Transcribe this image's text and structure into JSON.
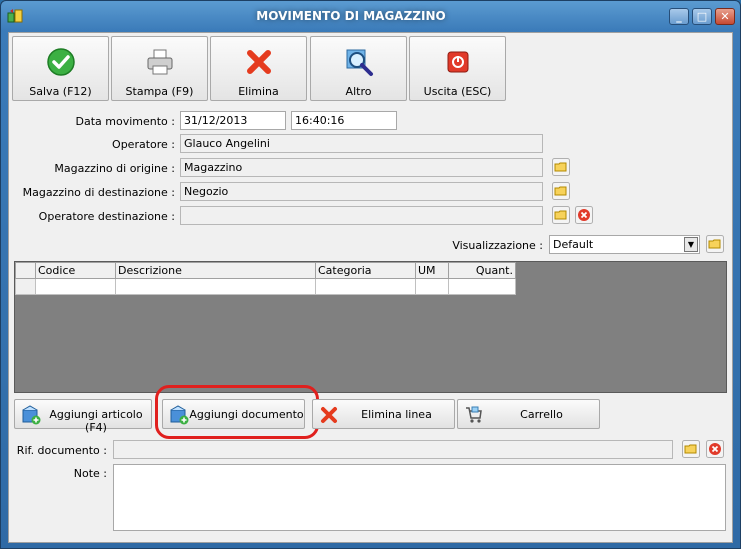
{
  "window": {
    "title": "MOVIMENTO DI MAGAZZINO",
    "min": "_",
    "max": "□",
    "close": "✕"
  },
  "toolbar": {
    "save_label": "Salva (F12)",
    "print_label": "Stampa (F9)",
    "delete_label": "Elimina",
    "other_label": "Altro",
    "exit_label": "Uscita (ESC)"
  },
  "form": {
    "date_label": "Data movimento :",
    "date_value": "31/12/2013",
    "time_value": "16:40:16",
    "operator_label": "Operatore :",
    "operator_value": "Glauco Angelini",
    "origin_label": "Magazzino di origine :",
    "origin_value": "Magazzino",
    "dest_label": "Magazzino di destinazione :",
    "dest_value": "Negozio",
    "dest_operator_label": "Operatore destinazione :",
    "dest_operator_value": "",
    "view_label": "Visualizzazione :",
    "view_value": "Default"
  },
  "grid": {
    "columns": [
      "Codice",
      "Descrizione",
      "Categoria",
      "UM",
      "Quant."
    ]
  },
  "actions": {
    "add_article": "Aggiungi articolo (F4)",
    "add_document": "Aggiungi documento",
    "delete_line": "Elimina linea",
    "cart": "Carrello"
  },
  "bottom": {
    "doc_ref_label": "Rif. documento :",
    "doc_ref_value": "",
    "notes_label": "Note :",
    "notes_value": ""
  },
  "colors": {
    "highlight": "#e0201e",
    "grid_bg": "#808080",
    "title_bg": "#3b7bb9"
  }
}
